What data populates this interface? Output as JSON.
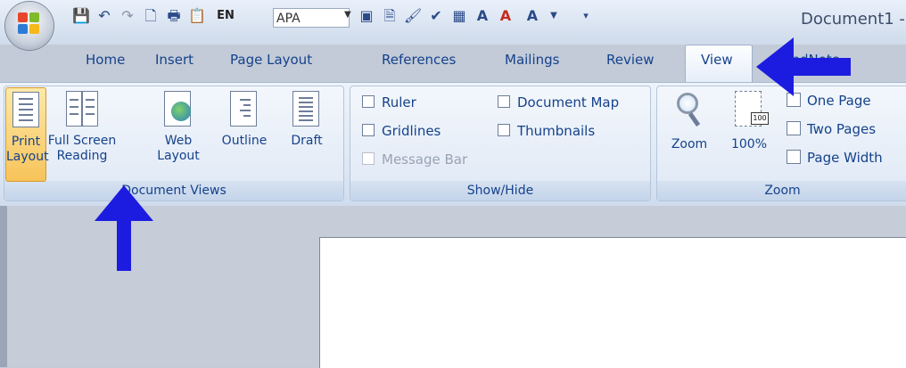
{
  "window": {
    "title": "Document1 -"
  },
  "quick_access": {
    "icons": [
      "save-icon",
      "undo-icon",
      "redo-icon",
      "new-document-icon",
      "print-icon",
      "paste-special-icon",
      "language-icon",
      "apa-style-box",
      "envelope-icon",
      "view-icon",
      "format-painter-icon",
      "spelling-icon",
      "table-icon",
      "font-icon",
      "highlight-icon",
      "text-effects-icon"
    ],
    "language_label": "EN",
    "style_value": "APA"
  },
  "tabs": [
    {
      "label": "Home"
    },
    {
      "label": "Insert"
    },
    {
      "label": "Page Layout"
    },
    {
      "label": "References"
    },
    {
      "label": "Mailings"
    },
    {
      "label": "Review"
    },
    {
      "label": "View",
      "active": true
    },
    {
      "label": "EndNote"
    }
  ],
  "groups": {
    "document_views": {
      "label": "Document Views",
      "buttons": [
        {
          "label_line1": "Print",
          "label_line2": "Layout",
          "selected": true
        },
        {
          "label_line1": "Full Screen",
          "label_line2": "Reading"
        },
        {
          "label_line1": "Web",
          "label_line2": "Layout"
        },
        {
          "label_line1": "Outline",
          "label_line2": ""
        },
        {
          "label_line1": "Draft",
          "label_line2": ""
        }
      ]
    },
    "show_hide": {
      "label": "Show/Hide",
      "items": [
        {
          "label": "Ruler"
        },
        {
          "label": "Gridlines"
        },
        {
          "label": "Message Bar",
          "disabled": true
        },
        {
          "label": "Document Map"
        },
        {
          "label": "Thumbnails"
        }
      ]
    },
    "zoom": {
      "label": "Zoom",
      "zoom_label": "Zoom",
      "percent_label": "100%",
      "percent_icon_text": "100",
      "items": [
        {
          "label": "One Page"
        },
        {
          "label": "Two Pages"
        },
        {
          "label": "Page Width"
        }
      ]
    }
  },
  "colors": {
    "annotation_arrow": "#1c1ce0",
    "accent": "#15428b",
    "selected": "#f7c35a"
  }
}
